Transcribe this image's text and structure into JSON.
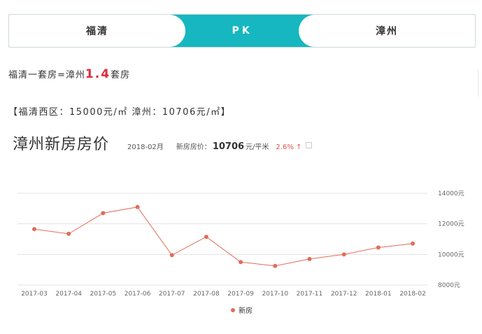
{
  "compare_bar": {
    "left_city": "福清",
    "middle_label": "PK",
    "right_city": "漳州"
  },
  "equation": {
    "prefix": "福清一套房=漳州",
    "ratio": "1.4",
    "suffix": "套房"
  },
  "price_line": "【福清西区：15000元/㎡ 漳州：10706元/㎡】",
  "chart_header": {
    "title": "漳州新房房价",
    "date": "2018-02月",
    "price_label": "新房房价：",
    "price_value": "10706",
    "unit": "元/平米",
    "change": "2.6% ↑"
  },
  "colors": {
    "accent": "#16b7c0",
    "ratio_red": "#e0273a",
    "series_line": "#e06d59",
    "change_red": "#e05050"
  },
  "chart_data": {
    "type": "line",
    "categories": [
      "2017-03",
      "2017-04",
      "2017-05",
      "2017-06",
      "2017-07",
      "2017-08",
      "2017-09",
      "2017-10",
      "2017-11",
      "2017-12",
      "2018-01",
      "2018-02"
    ],
    "series": [
      {
        "name": "新房",
        "values": [
          11650,
          11350,
          12700,
          13100,
          9950,
          11150,
          9500,
          9250,
          9700,
          10000,
          10450,
          10706
        ]
      }
    ],
    "ylim": [
      8000,
      14000
    ],
    "y_ticks": [
      "8000元",
      "10000元",
      "12000元",
      "14000元"
    ],
    "y_tick_values": [
      8000,
      10000,
      12000,
      14000
    ],
    "grid": true,
    "legend_position": "bottom-center"
  }
}
